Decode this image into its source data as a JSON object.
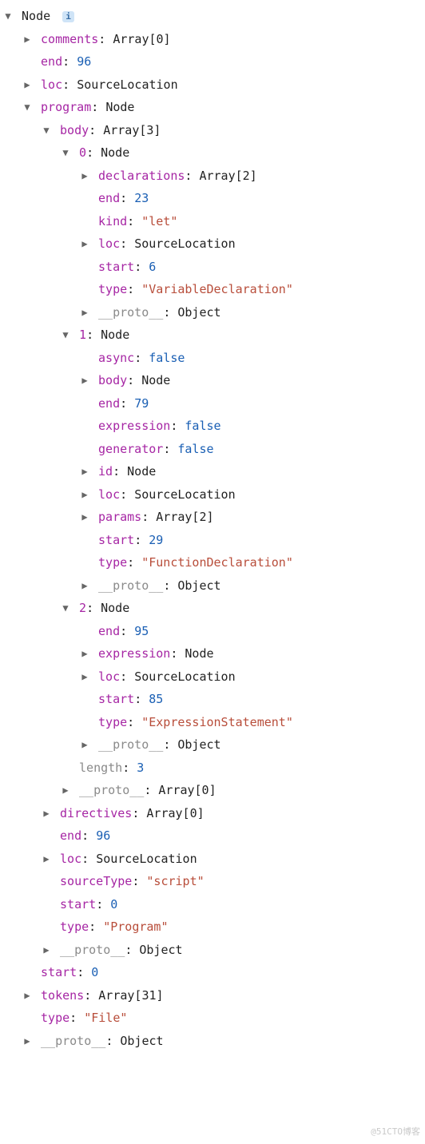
{
  "watermark": "@51CTO博客",
  "info_badge": "i",
  "root": {
    "name": "Node"
  },
  "tree": {
    "comments": {
      "key": "comments",
      "value": "Array[0]"
    },
    "end": {
      "key": "end",
      "value": "96"
    },
    "loc": {
      "key": "loc",
      "value": "SourceLocation"
    },
    "program": {
      "key": "program",
      "value": "Node"
    },
    "program_children": {
      "body": {
        "key": "body",
        "value": "Array[3]"
      },
      "b0": {
        "key": "0",
        "value": "Node"
      },
      "b0c": {
        "declarations": {
          "key": "declarations",
          "value": "Array[2]"
        },
        "end": {
          "key": "end",
          "value": "23"
        },
        "kind": {
          "key": "kind",
          "value": "\"let\""
        },
        "loc": {
          "key": "loc",
          "value": "SourceLocation"
        },
        "start": {
          "key": "start",
          "value": "6"
        },
        "type": {
          "key": "type",
          "value": "\"VariableDeclaration\""
        },
        "proto": {
          "key": "__proto__",
          "value": "Object"
        }
      },
      "b1": {
        "key": "1",
        "value": "Node"
      },
      "b1c": {
        "async": {
          "key": "async",
          "value": "false"
        },
        "body": {
          "key": "body",
          "value": "Node"
        },
        "end": {
          "key": "end",
          "value": "79"
        },
        "expression": {
          "key": "expression",
          "value": "false"
        },
        "generator": {
          "key": "generator",
          "value": "false"
        },
        "id": {
          "key": "id",
          "value": "Node"
        },
        "loc": {
          "key": "loc",
          "value": "SourceLocation"
        },
        "params": {
          "key": "params",
          "value": "Array[2]"
        },
        "start": {
          "key": "start",
          "value": "29"
        },
        "type": {
          "key": "type",
          "value": "\"FunctionDeclaration\""
        },
        "proto": {
          "key": "__proto__",
          "value": "Object"
        }
      },
      "b2": {
        "key": "2",
        "value": "Node"
      },
      "b2c": {
        "end": {
          "key": "end",
          "value": "95"
        },
        "expression": {
          "key": "expression",
          "value": "Node"
        },
        "loc": {
          "key": "loc",
          "value": "SourceLocation"
        },
        "start": {
          "key": "start",
          "value": "85"
        },
        "type": {
          "key": "type",
          "value": "\"ExpressionStatement\""
        },
        "proto": {
          "key": "__proto__",
          "value": "Object"
        }
      },
      "length": {
        "key": "length",
        "value": "3"
      },
      "body_proto": {
        "key": "__proto__",
        "value": "Array[0]"
      },
      "directives": {
        "key": "directives",
        "value": "Array[0]"
      },
      "pend": {
        "key": "end",
        "value": "96"
      },
      "ploc": {
        "key": "loc",
        "value": "SourceLocation"
      },
      "sourceType": {
        "key": "sourceType",
        "value": "\"script\""
      },
      "pstart": {
        "key": "start",
        "value": "0"
      },
      "ptype": {
        "key": "type",
        "value": "\"Program\""
      },
      "pproto": {
        "key": "__proto__",
        "value": "Object"
      }
    },
    "start": {
      "key": "start",
      "value": "0"
    },
    "tokens": {
      "key": "tokens",
      "value": "Array[31]"
    },
    "type": {
      "key": "type",
      "value": "\"File\""
    },
    "root_proto": {
      "key": "__proto__",
      "value": "Object"
    }
  }
}
